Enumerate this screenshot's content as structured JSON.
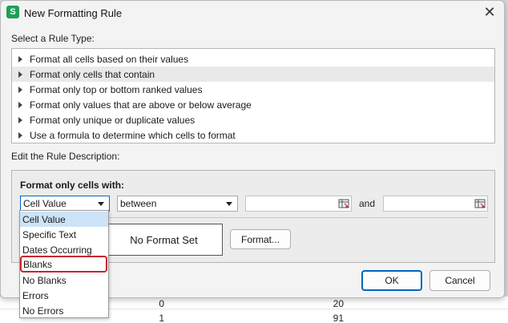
{
  "dialog": {
    "title": "New Formatting Rule",
    "app_icon_letter": "S",
    "close_glyph": "✕"
  },
  "rule_type": {
    "label": "Select a Rule Type:",
    "items": [
      "Format all cells based on their values",
      "Format only cells that contain",
      "Format only top or bottom ranked values",
      "Format only values that are above or below average",
      "Format only unique or duplicate values",
      "Use a formula to determine which cells to format"
    ],
    "selected_index": 1
  },
  "description": {
    "label": "Edit the Rule Description:",
    "heading": "Format only cells with:",
    "condition_value": "Cell Value",
    "operator_value": "between",
    "and_label": "and",
    "preview_text": "No Format Set",
    "format_button": "Format..."
  },
  "condition_options": [
    "Cell Value",
    "Specific Text",
    "Dates Occurring",
    "Blanks",
    "No Blanks",
    "Errors",
    "No Errors"
  ],
  "buttons": {
    "ok": "OK",
    "cancel": "Cancel"
  },
  "background_sheet": {
    "row1": [
      "0",
      "20"
    ],
    "row2": [
      "1",
      "91"
    ]
  },
  "colors": {
    "accent": "#0067c0",
    "highlight": "#cde3f7",
    "annotation_red": "#c8242e",
    "app_icon_green": "#1e9e57"
  }
}
